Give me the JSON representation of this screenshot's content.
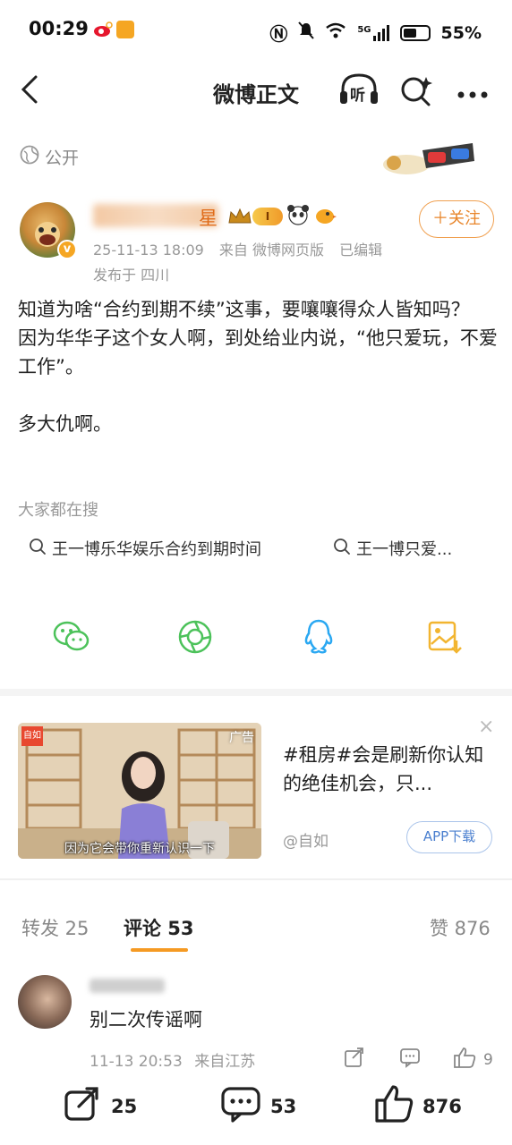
{
  "status_bar": {
    "time": "00:29",
    "signal": "5G",
    "battery": "55%"
  },
  "nav": {
    "title": "微博正文",
    "listen_label": "听"
  },
  "post": {
    "visibility": "公开",
    "username": "星",
    "level": "I",
    "date": "25-11-13 18:09",
    "source": "来自 微博网页版",
    "edited": "已编辑",
    "location": "发布于 四川",
    "follow_label": "＋关注",
    "text": "知道为啥“合约到期不续”这事，要嚷嚷得众人皆知吗？\n因为华华子这个女人啊，到处给业内说，“他只爱玩，不爱工作”。\n\n多大仇啊。"
  },
  "search": {
    "label": "大家都在搜",
    "items": [
      "王一博乐华娱乐合约到期时间",
      "王一博只爱..."
    ]
  },
  "share": {
    "targets": [
      "wechat",
      "moments",
      "qq",
      "save-image"
    ]
  },
  "ad": {
    "badge": "广告",
    "brand": "自如",
    "caption": "因为它会带你重新认识一下",
    "text": "#租房#会是刷新你认知的绝佳机会，只...",
    "source": "@自如",
    "button": "APP下载",
    "close": "×"
  },
  "tabs": {
    "repost": "转发 25",
    "comment": "评论 53",
    "like": "赞 876"
  },
  "comment": {
    "text": "别二次传谣啊",
    "date": "11-13 20:53",
    "location": "来自江苏",
    "likes": "9"
  },
  "bottom": {
    "repost_count": "25",
    "comment_count": "53",
    "like_count": "876"
  },
  "colors": {
    "accent": "#f59a23",
    "username": "#e06c1a",
    "wechat": "#4cc25a",
    "qq": "#2aa8f2",
    "save": "#f2b530"
  }
}
